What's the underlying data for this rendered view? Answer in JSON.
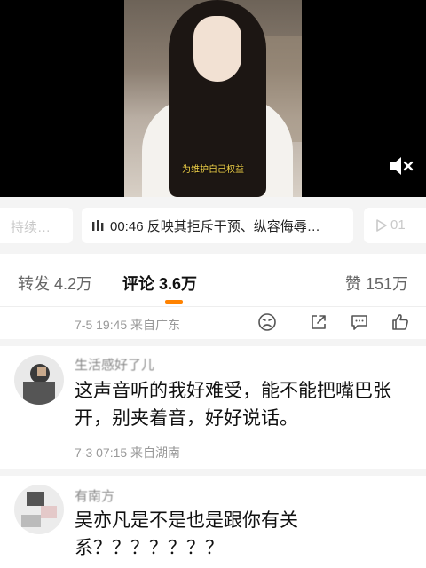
{
  "video": {
    "caption": "为维护自己权益",
    "mute_icon": "mute-icon"
  },
  "playlist": {
    "prev_partial": "持续…",
    "current_icon": "audio-bars-icon",
    "current": "00:46 反映其拒斥干预、纵容侮辱…",
    "next_icon": "play-icon",
    "next_partial": "01"
  },
  "tabs": {
    "repost": "转发 4.2万",
    "comment": "评论 3.6万",
    "like": "赞 151万",
    "active_color": "#ff8200"
  },
  "comments": [
    {
      "meta": "7-5 19:45  来自广东",
      "actions": [
        "sad-face-icon",
        "share-icon",
        "reply-icon",
        "like-icon"
      ]
    },
    {
      "username": "生活感好了儿",
      "text": "这声音听的我好难受，能不能把嘴巴张开，别夹着音，好好说话。",
      "meta": "7-3 07:15  来自湖南"
    },
    {
      "username": "有南方",
      "text": "吴亦凡是不是也是跟你有关系？？？？？？？"
    }
  ]
}
